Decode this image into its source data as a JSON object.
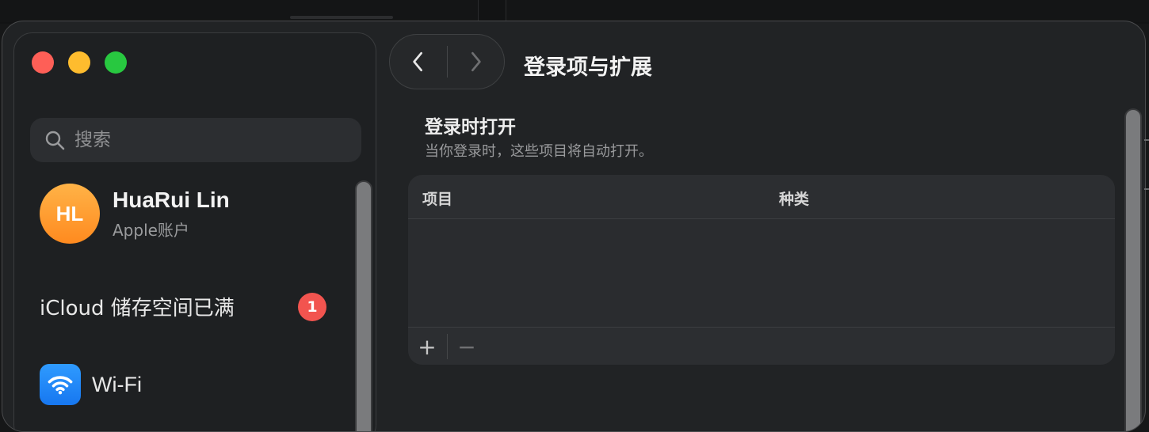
{
  "window": {
    "title": "登录项与扩展"
  },
  "sidebar": {
    "search": {
      "placeholder": "搜索"
    },
    "account": {
      "initials": "HL",
      "name": "HuaRui Lin",
      "subtitle": "Apple账户"
    },
    "items": [
      {
        "label": "iCloud 储存空间已满",
        "badge": "1"
      },
      {
        "label": "Wi-Fi",
        "icon": "wifi-icon"
      }
    ]
  },
  "section": {
    "title": "登录时打开",
    "subtitle": "当你登录时，这些项目将自动打开。"
  },
  "table": {
    "columns": [
      "项目",
      "种类"
    ],
    "rows": [],
    "add_label": "+",
    "remove_label": "−"
  },
  "colors": {
    "badge": "#f2544f",
    "avatar": "#ff9a2e",
    "wifi_tile": "#1e86f7",
    "close": "#fe5f57",
    "minimize": "#febc2e",
    "zoom": "#28c840"
  }
}
